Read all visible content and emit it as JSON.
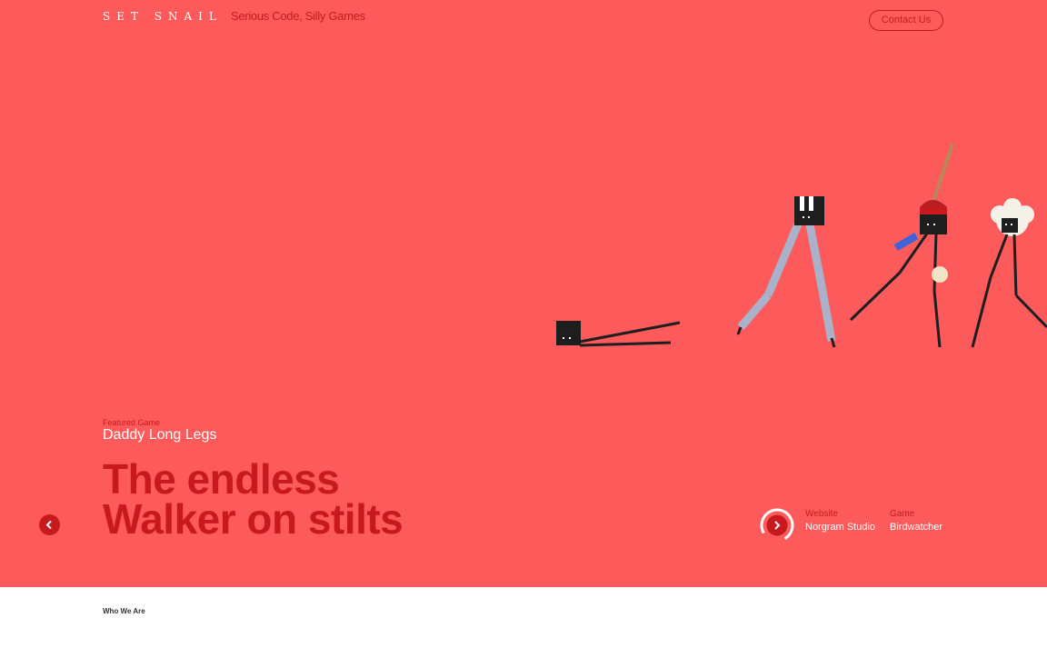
{
  "header": {
    "logo": "SET SNAIL",
    "tagline": "Serious Code, Silly Games",
    "contact_label": "Contact Us"
  },
  "featured": {
    "label": "Featured Game",
    "name": "Daddy Long Legs",
    "headline_line1": "The endless",
    "headline_line2": "Walker on stilts"
  },
  "meta": {
    "website_label": "Website",
    "website_value": "Norgram Studio",
    "game_label": "Game",
    "game_value": "Birdwatcher"
  },
  "section": {
    "who_label": "Who We Are"
  },
  "colors": {
    "hero_bg": "#fd5b5b",
    "accent": "#c8191f",
    "text_light": "#ffffff"
  },
  "icons": {
    "prev": "chevron-left-icon",
    "next": "chevron-right-icon"
  }
}
